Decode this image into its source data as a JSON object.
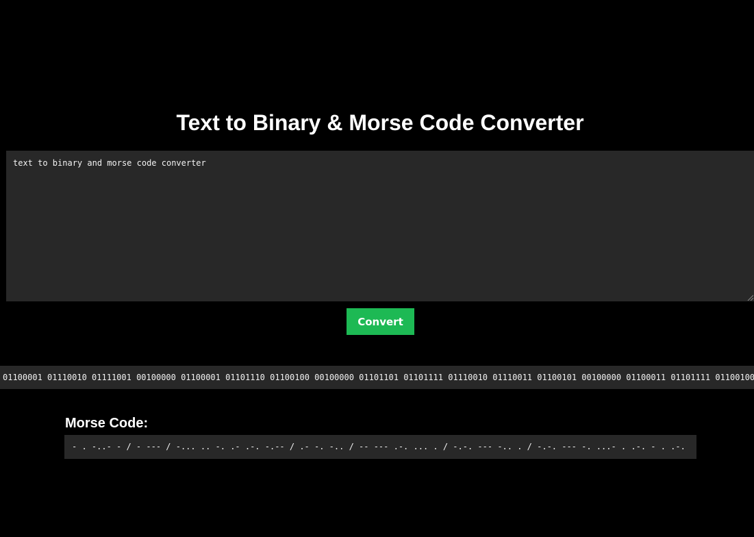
{
  "page": {
    "title": "Text to Binary & Morse Code Converter"
  },
  "input": {
    "value": "text to binary and morse code converter"
  },
  "convert_button": {
    "label": "Convert"
  },
  "binary_output": {
    "value": "01100001 01110010 01111001 00100000 01100001 01101110 01100100 00100000 01101101 01101111 01110010 01110011 01100101 00100000 01100011 01101111 01100100"
  },
  "morse": {
    "heading": "Morse Code:",
    "value": "- . -..- - / - --- / -... .. -. .- .-. -.-- / .- -. -.. / -- --- .-. ... . / -.-. --- -.. . / -.-. --- -. ...- . .-. - . .-."
  },
  "colors": {
    "background": "#000000",
    "panel": "#282828",
    "accent_button": "#1db954",
    "text": "#ffffff"
  }
}
